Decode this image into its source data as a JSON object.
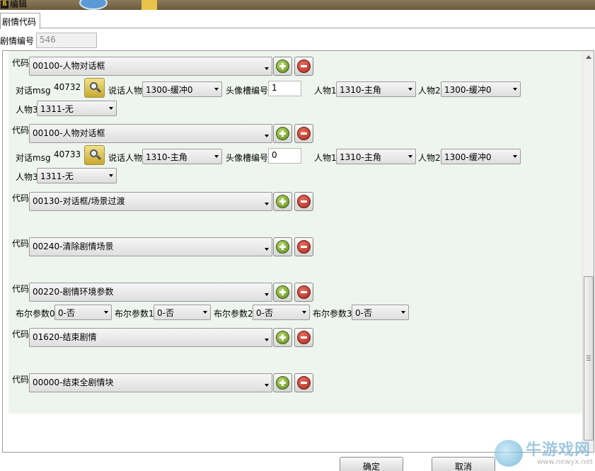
{
  "window": {
    "title": "编辑"
  },
  "tab": {
    "label": "剧情代码"
  },
  "plot_id": {
    "label": "剧情编号",
    "value": "546"
  },
  "labels": {
    "code": "代码",
    "dialog_msg": "对话msg",
    "speaker": "说话人物",
    "portrait_slot": "头像槽编号",
    "person1": "人物1",
    "person2": "人物2",
    "person3": "人物3",
    "bool0": "布尔参数0",
    "bool1": "布尔参数1",
    "bool2": "布尔参数2",
    "bool3": "布尔参数3"
  },
  "blocks": [
    {
      "code": "00100-人物对话框",
      "msg": "40732",
      "speaker": "1300-缓冲0",
      "slot": "1",
      "person1": "1310-主角",
      "person2": "1300-缓冲0",
      "person3": "1311-无"
    },
    {
      "code": "00100-人物对话框",
      "msg": "40733",
      "speaker": "1310-主角",
      "slot": "0",
      "person1": "1310-主角",
      "person2": "1300-缓冲0",
      "person3": "1311-无"
    },
    {
      "code": "00130-对话框/场景过渡"
    },
    {
      "code": "00240-清除剧情场景"
    },
    {
      "code": "00220-剧情环境参数",
      "bool0": "0-否",
      "bool1": "0-否",
      "bool2": "0-否",
      "bool3": "0-否"
    },
    {
      "code": "01620-结束剧情"
    },
    {
      "code": "00000-结束全剧情块"
    }
  ],
  "buttons": {
    "ok": "确定",
    "cancel": "取消"
  },
  "watermark": {
    "text": "牛游戏网",
    "url": "www.newyx.net"
  },
  "icons": [
    "add-icon",
    "remove-icon",
    "search-icon",
    "dropdown-arrow-icon",
    "scroll-up-icon"
  ],
  "colors": {
    "block_bg": "#eef5ee",
    "add_green": "#5c8a1a",
    "remove_red": "#a8281a",
    "search_gold": "#c8a830"
  }
}
